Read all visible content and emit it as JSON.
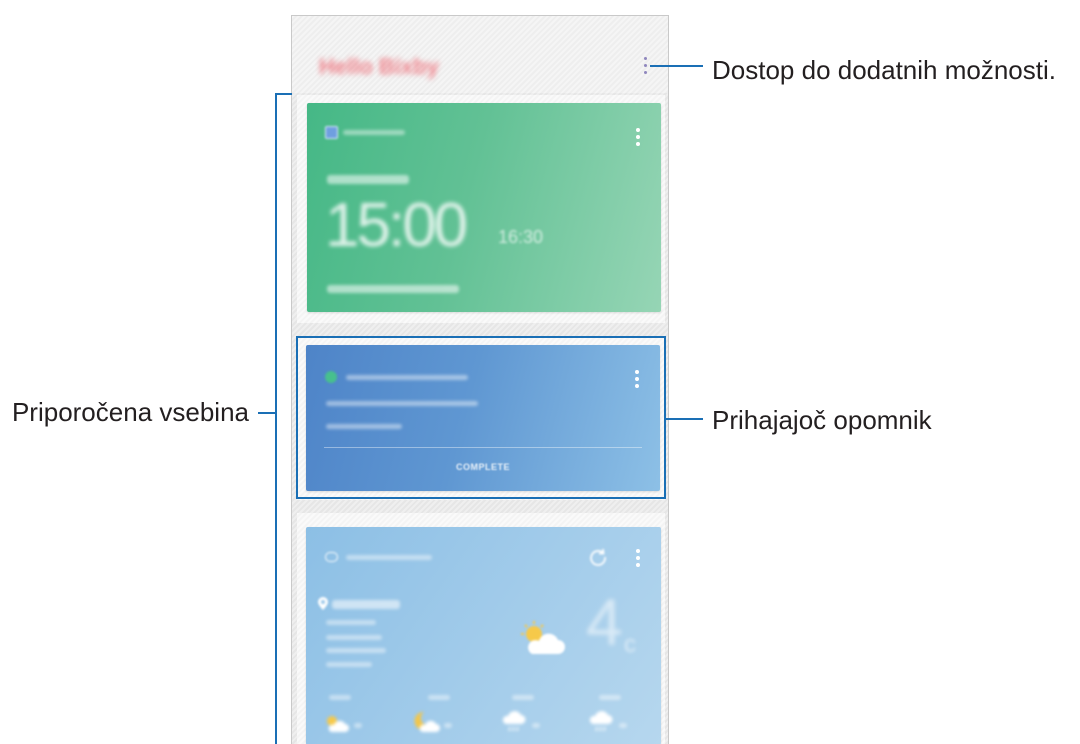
{
  "header": {
    "title": "Hello Bixby",
    "more_options_icon": "more-vert-icon"
  },
  "cards": [
    {
      "id": "schedule",
      "icon": "calendar-icon",
      "menu_icon": "more-vert-icon",
      "time": "15:00",
      "end_time": "16:30",
      "accent": "#45b886"
    },
    {
      "id": "reminder",
      "icon": "reminder-icon",
      "menu_icon": "more-vert-icon",
      "action_label": "COMPLETE",
      "highlighted": true,
      "accent": "#4e84c8"
    },
    {
      "id": "weather",
      "icon": "weather-icon",
      "refresh_icon": "refresh-icon",
      "menu_icon": "more-vert-icon",
      "location_icon": "location-pin-icon",
      "condition_icon": "partly-sunny-icon",
      "temperature": "4",
      "unit": "c",
      "hourly_icons": [
        "partly-sunny-icon",
        "night-cloudy-icon",
        "rain-icon",
        "rain-icon"
      ],
      "accent": "#8cbfe5"
    }
  ],
  "callouts": {
    "more_options": "Dostop do dodatnih možnosti.",
    "upcoming_reminder": "Prihajajoč opomnik",
    "recommended_content": "Priporočena vsebina"
  },
  "colors": {
    "callout_line": "#1a6fb5",
    "header_title": "#ee7f88",
    "text": "#231f20"
  }
}
